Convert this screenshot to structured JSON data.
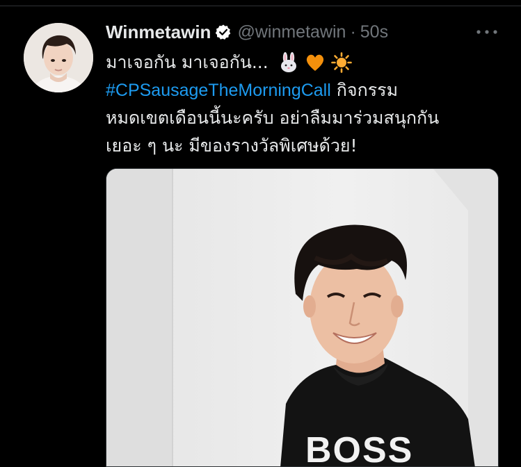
{
  "tweet": {
    "author_name": "Winmetawin",
    "handle": "@winmetawin",
    "separator": "·",
    "time": "50s",
    "line1": "มาเจอกัน มาเจอกัน...",
    "hashtag": "#CPSausageTheMorningCall",
    "line2_rest": "กิจกรรม",
    "line3": "หมดเขตเดือนนี้นะครับ อย่าลืมมาร่วมสนุกกัน",
    "line4": "เยอะ ๆ นะ มีของรางวัลพิเศษด้วย!",
    "emojis": [
      "rabbit-face-icon",
      "orange-heart-icon",
      "sun-icon"
    ],
    "media_text": "BOSS"
  },
  "colors": {
    "background": "#000000",
    "text": "#e7e9ea",
    "secondary_text": "#71767b",
    "link": "#1d9bf0",
    "verified": "#ffffff"
  }
}
